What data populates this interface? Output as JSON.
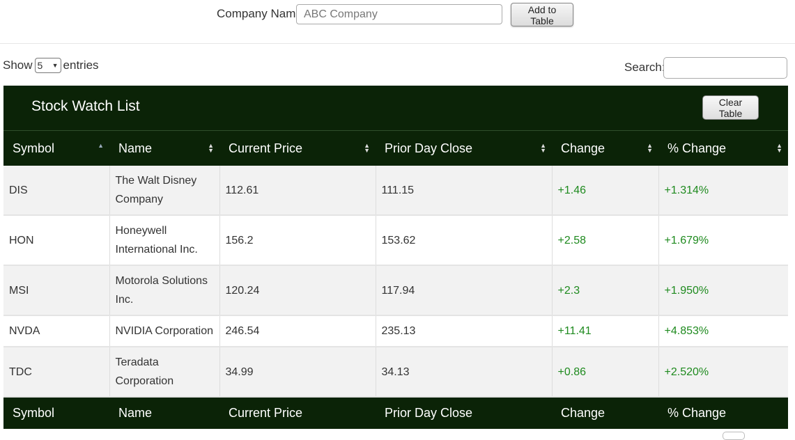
{
  "form": {
    "company_label": "Company Name",
    "company_placeholder": "ABC Company",
    "add_button": "Add to Table"
  },
  "length": {
    "show_label": "Show",
    "selected": "5",
    "entries_label": "entries"
  },
  "search": {
    "label": "Search:",
    "value": ""
  },
  "table": {
    "title": "Stock Watch List",
    "clear_button": "Clear Table",
    "columns": [
      "Symbol",
      "Name",
      "Current Price",
      "Prior Day Close",
      "Change",
      "% Change"
    ],
    "rows": [
      {
        "symbol": "DIS",
        "name": "The Walt Disney Company",
        "price": "112.61",
        "prior": "111.15",
        "change": "+1.46",
        "pct": "+1.314%"
      },
      {
        "symbol": "HON",
        "name": "Honeywell International Inc.",
        "price": "156.2",
        "prior": "153.62",
        "change": "+2.58",
        "pct": "+1.679%"
      },
      {
        "symbol": "MSI",
        "name": "Motorola Solutions Inc.",
        "price": "120.24",
        "prior": "117.94",
        "change": "+2.3",
        "pct": "+1.950%"
      },
      {
        "symbol": "NVDA",
        "name": "NVIDIA Corporation",
        "price": "246.54",
        "prior": "235.13",
        "change": "+11.41",
        "pct": "+4.853%"
      },
      {
        "symbol": "TDC",
        "name": "Teradata Corporation",
        "price": "34.99",
        "prior": "34.13",
        "change": "+0.86",
        "pct": "+2.520%"
      }
    ]
  },
  "colors": {
    "header_bg": "#0b2307",
    "positive": "#1e8a1e"
  },
  "icons": {
    "sort_asc": "sort-asc-icon",
    "sort_both": "sort-both-icon",
    "dropdown": "dropdown-arrow-icon"
  }
}
